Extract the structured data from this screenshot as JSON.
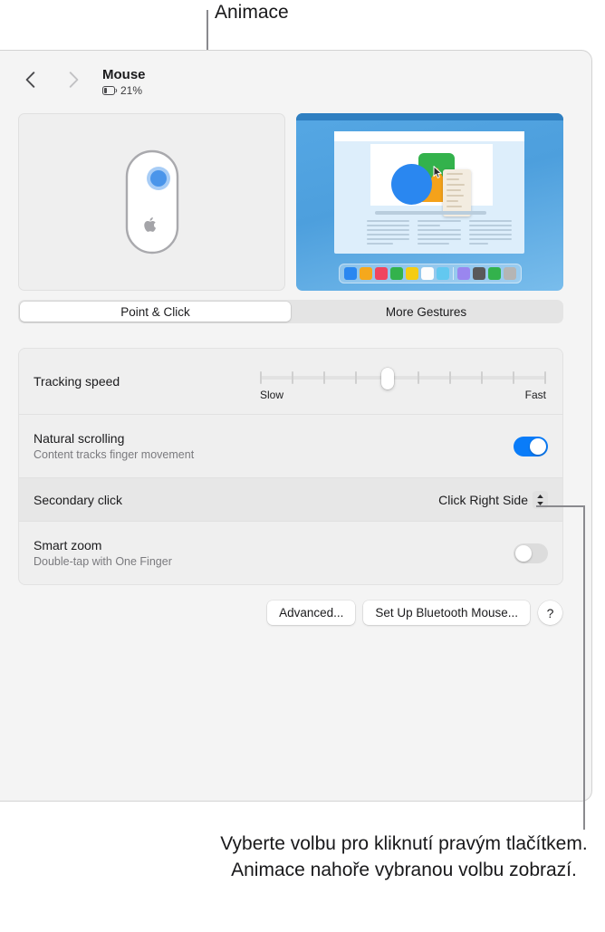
{
  "callouts": {
    "top_label": "Animace",
    "bottom_text": "Vyberte volbu pro kliknutí pravým tlačítkem. Animace nahoře vybranou volbu zobrazí."
  },
  "toolbar": {
    "back_icon": "chevron-left-icon",
    "forward_icon": "chevron-right-icon",
    "title": "Mouse",
    "battery_icon": "battery-icon",
    "battery_level": "21%",
    "battery_percent": 21
  },
  "preview": {
    "mouse_illustration": "magic-mouse-icon",
    "click_indicator_side": "right",
    "apple_logo": "apple-logo-icon",
    "animation_cursor": "pointer-cursor-icon",
    "dock_colors": [
      "#2a87f0",
      "#f5a81c",
      "#f0455f",
      "#33b24c",
      "#f5cc12",
      "#fdfdfd",
      "#63c8f0",
      "#9a86ef",
      "#595959",
      "#33b24c",
      "#b5b5b5"
    ],
    "dock_separator_after_index": 7
  },
  "tabs": [
    {
      "label": "Point & Click",
      "selected": true
    },
    {
      "label": "More Gestures",
      "selected": false
    }
  ],
  "settings": {
    "tracking_speed": {
      "title": "Tracking speed",
      "slow_label": "Slow",
      "fast_label": "Fast",
      "ticks": 10,
      "value_index": 4
    },
    "natural_scrolling": {
      "title": "Natural scrolling",
      "subtitle": "Content tracks finger movement",
      "toggle_state": "on"
    },
    "secondary_click": {
      "title": "Secondary click",
      "value": "Click Right Side",
      "chevron_icon": "chevron-up-down-icon",
      "highlighted": true
    },
    "smart_zoom": {
      "title": "Smart zoom",
      "subtitle": "Double-tap with One Finger",
      "toggle_state": "off"
    }
  },
  "buttons": {
    "advanced": "Advanced...",
    "bluetooth_setup": "Set Up Bluetooth Mouse...",
    "help": "?"
  },
  "colors": {
    "accent_blue": "#0a7cf8",
    "window_bg": "#f4f4f4",
    "panel_bg": "#efefef",
    "row_highlight": "#e7e7e7",
    "leader_line": "#8a8a8e"
  }
}
